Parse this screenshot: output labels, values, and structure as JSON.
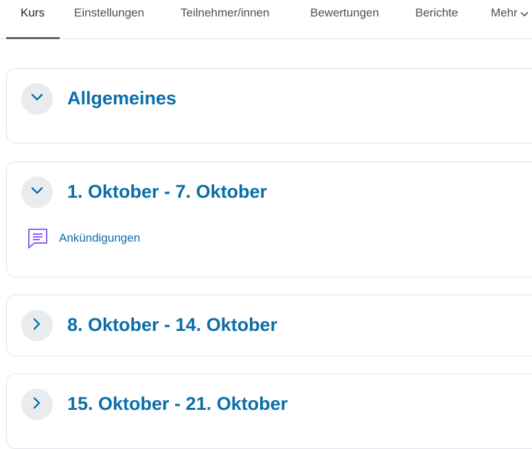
{
  "tabs": [
    {
      "label": "Kurs",
      "active": true
    },
    {
      "label": "Einstellungen"
    },
    {
      "label": "Teilnehmer/innen"
    },
    {
      "label": "Bewertungen"
    },
    {
      "label": "Berichte"
    },
    {
      "label": "Mehr"
    }
  ],
  "sections": [
    {
      "title": "Allgemeines",
      "expanded": true
    },
    {
      "title": "1. Oktober - 7. Oktober",
      "expanded": true,
      "activity": {
        "label": "Ankündigungen",
        "icon": "forum-icon"
      }
    },
    {
      "title": "8. Oktober - 14. Oktober",
      "expanded": false
    },
    {
      "title": "15. Oktober - 21. Oktober",
      "expanded": false
    }
  ],
  "colors": {
    "accent": "#0a6ea8",
    "forum_icon": "#8b5cf6"
  }
}
